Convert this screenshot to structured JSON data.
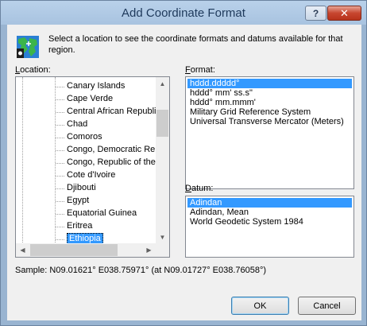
{
  "window": {
    "title": "Add Coordinate Format",
    "help_label": "?",
    "close_label": "✕"
  },
  "intro_text": "Select a location to see the coordinate formats and datums available for that region.",
  "location": {
    "label_prefix": "L",
    "label_rest": "ocation:",
    "items": [
      "Canary Islands",
      "Cape Verde",
      "Central African Republic",
      "Chad",
      "Comoros",
      "Congo, Democratic Rep",
      "Congo, Republic of the",
      "Cote d'Ivoire",
      "Djibouti",
      "Egypt",
      "Equatorial Guinea",
      "Eritrea",
      "Ethiopia"
    ],
    "selected": "Ethiopia"
  },
  "format": {
    "label_prefix": "F",
    "label_rest": "ormat:",
    "items": [
      "hddd.ddddd°",
      "hddd° mm' ss.s\"",
      "hddd° mm.mmm'",
      "Military Grid Reference System",
      "Universal Transverse Mercator (Meters)"
    ],
    "selected": "hddd.ddddd°"
  },
  "datum": {
    "label_prefix": "D",
    "label_rest": "atum:",
    "items": [
      "Adindan",
      "Adindan, Mean",
      "World Geodetic System 1984"
    ],
    "selected": "Adindan"
  },
  "sample_text": "Sample: N09.01621°  E038.75971° (at N09.01727°  E038.76058°)",
  "buttons": {
    "ok": "OK",
    "cancel": "Cancel"
  },
  "colors": {
    "selection": "#3399ff",
    "titlebar": "#b9d1ea",
    "close": "#c7462f"
  },
  "icons": {
    "app": "globe-map-icon"
  }
}
